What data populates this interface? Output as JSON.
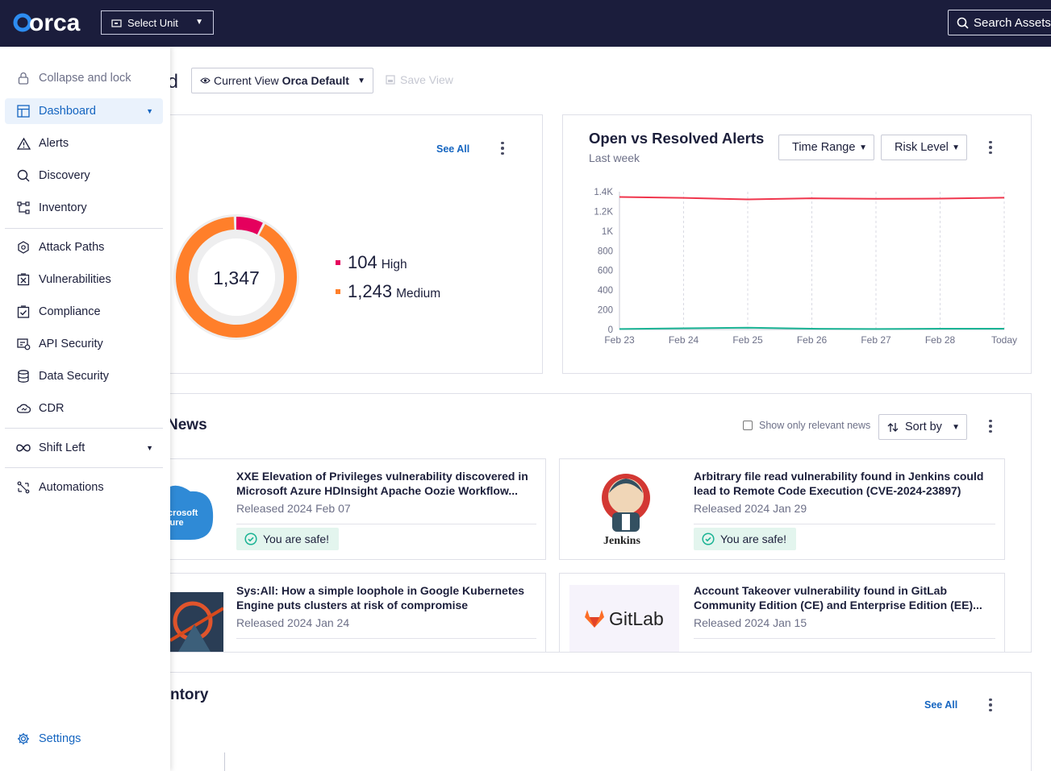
{
  "brand": "orca",
  "topbar": {
    "unit_select": "Select Unit",
    "search_placeholder": "Search Assets,"
  },
  "sidebar": {
    "collapse": "Collapse and lock",
    "items": [
      {
        "label": "Dashboard",
        "icon": "dashboard-icon"
      },
      {
        "label": "Alerts",
        "icon": "warning-icon"
      },
      {
        "label": "Discovery",
        "icon": "search-icon"
      },
      {
        "label": "Inventory",
        "icon": "inventory-icon"
      },
      {
        "label": "Attack Paths",
        "icon": "attack-paths-icon"
      },
      {
        "label": "Vulnerabilities",
        "icon": "vulnerabilities-icon"
      },
      {
        "label": "Compliance",
        "icon": "compliance-icon"
      },
      {
        "label": "API Security",
        "icon": "api-security-icon"
      },
      {
        "label": "Data Security",
        "icon": "database-icon"
      },
      {
        "label": "CDR",
        "icon": "cloud-icon"
      },
      {
        "label": "Shift Left",
        "icon": "infinity-icon"
      },
      {
        "label": "Automations",
        "icon": "automations-icon"
      }
    ],
    "settings": "Settings"
  },
  "header": {
    "title_fragment": "d",
    "view_label": "Current View",
    "view_value": "Orca Default",
    "save_view": "Save View"
  },
  "alerts_card": {
    "see_all": "See All",
    "total": "1,347",
    "legend": [
      {
        "value": "104",
        "label": "High",
        "color": "#e5005d",
        "fraction": 0.077
      },
      {
        "value": "1,243",
        "label": "Medium",
        "color": "#ff7f2a",
        "fraction": 0.923
      }
    ]
  },
  "trend_card": {
    "title": "Open vs Resolved Alerts",
    "subtitle": "Last week",
    "time_range": "Time Range",
    "risk_level": "Risk Level"
  },
  "chart_data": {
    "type": "line",
    "x": [
      "Feb 23",
      "Feb 24",
      "Feb 25",
      "Feb 26",
      "Feb 27",
      "Feb 28",
      "Today"
    ],
    "yticks": [
      "0",
      "200",
      "400",
      "600",
      "800",
      "1K",
      "1.2K",
      "1.4K"
    ],
    "ylim": [
      0,
      1400
    ],
    "series": [
      {
        "color": "#f0364d",
        "values": [
          1347,
          1338,
          1322,
          1333,
          1328,
          1330,
          1340
        ]
      },
      {
        "color": "#1ab394",
        "values": [
          5,
          12,
          18,
          8,
          5,
          8,
          8
        ]
      }
    ]
  },
  "news": {
    "title_fragment": "News",
    "relevant_only": "Show only relevant news",
    "sort_by": "Sort by",
    "items": [
      {
        "title": "XXE Elevation of Privileges vulnerability discovered in Microsoft Azure HDInsight Apache Oozie Workflow...",
        "date": "Released 2024 Feb 07",
        "safe": "You are safe!",
        "logo_text": "icrosoft\nzure"
      },
      {
        "title": "Arbitrary file read vulnerability found in Jenkins could lead to Remote Code Execution (CVE-2024-23897)",
        "date": "Released 2024 Jan 29",
        "safe": "You are safe!",
        "logo_text": "Jenkins"
      },
      {
        "title": "Sys:All: How a simple loophole in Google Kubernetes Engine puts clusters at risk of compromise",
        "date": "Released 2024 Jan 24"
      },
      {
        "title": "Account Takeover vulnerability found in GitLab Community Edition (CE) and Enterprise Edition (EE)...",
        "date": "Released 2024 Jan 15",
        "logo_text": "GitLab"
      }
    ]
  },
  "inventory": {
    "title_fragment": "ntory",
    "see_all": "See All"
  }
}
